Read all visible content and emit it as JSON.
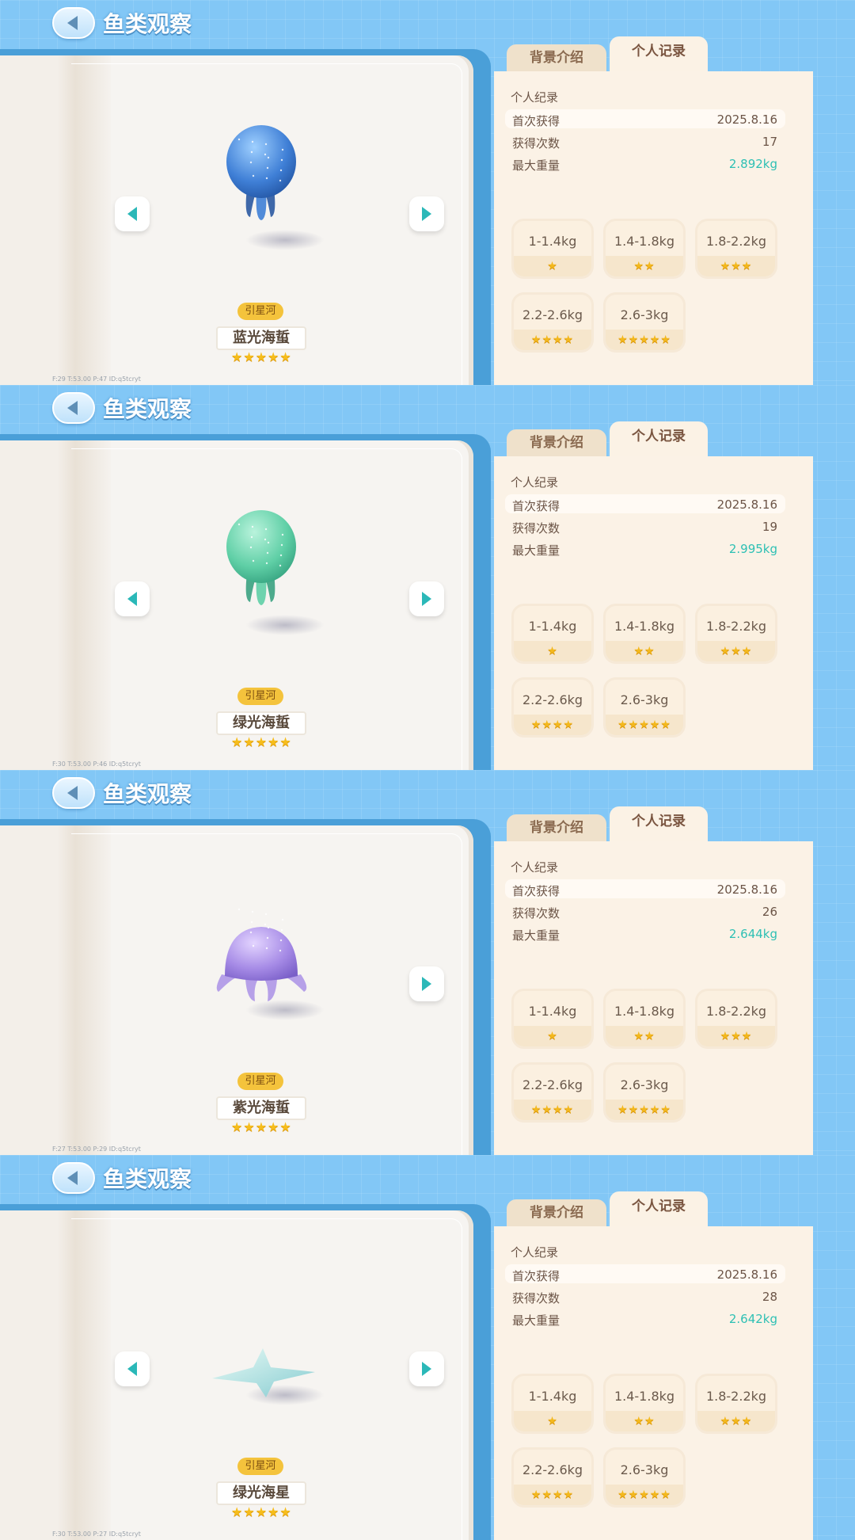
{
  "header": {
    "title": "鱼类观察"
  },
  "tabs": {
    "background": "背景介绍",
    "record": "个人记录"
  },
  "labels": {
    "section": "个人纪录",
    "first": "首次获得",
    "count": "获得次数",
    "maxw": "最大重量"
  },
  "weights": [
    "1-1.4kg",
    "1.4-1.8kg",
    "1.8-2.2kg",
    "2.2-2.6kg",
    "2.6-3kg"
  ],
  "weight_stars": [
    "★",
    "★★",
    "★★★",
    "★★★★",
    "★★★★★"
  ],
  "colors": {
    "accent_teal": "#2ec0b4",
    "star": "#f6bd1c",
    "badge": "#f4c33c"
  },
  "panels": [
    {
      "creature": "蓝光海蜇",
      "creature_icon": "blue-jellyfish-icon",
      "location": "引星河",
      "rating_stars": "★★★★★",
      "first_date": "2025.8.16",
      "times": "17",
      "max_weight": "2.892kg",
      "has_prev": true,
      "debug": "F:29   T:53.00   P:47   ID:q5tcryt"
    },
    {
      "creature": "绿光海蜇",
      "creature_icon": "green-jellyfish-icon",
      "location": "引星河",
      "rating_stars": "★★★★★",
      "first_date": "2025.8.16",
      "times": "19",
      "max_weight": "2.995kg",
      "has_prev": true,
      "debug": "F:30   T:53.00   P:46   ID:q5tcryt"
    },
    {
      "creature": "紫光海蜇",
      "creature_icon": "purple-jellyfish-icon",
      "location": "引星河",
      "rating_stars": "★★★★★",
      "first_date": "2025.8.16",
      "times": "26",
      "max_weight": "2.644kg",
      "has_prev": false,
      "debug": "F:27   T:53.00   P:29   ID:q5tcryt"
    },
    {
      "creature": "绿光海星",
      "creature_icon": "green-starfish-icon",
      "location": "引星河",
      "rating_stars": "★★★★★",
      "first_date": "2025.8.16",
      "times": "28",
      "max_weight": "2.642kg",
      "has_prev": true,
      "debug": "F:30   T:53.00   P:27   ID:q5tcryt"
    }
  ]
}
